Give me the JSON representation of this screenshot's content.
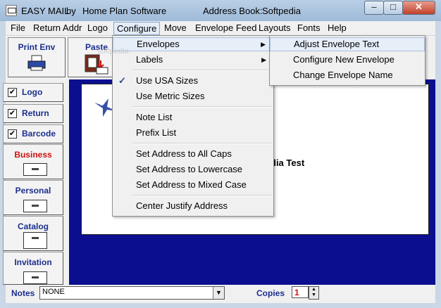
{
  "window": {
    "title_app": "EASY MAIL",
    "title_by": "by",
    "title_company": "Home Plan Software",
    "title_book_label": "Address Book:",
    "title_book_value": "Softpedia",
    "minimize": "–",
    "maximize": "□",
    "close": "✕"
  },
  "menubar": {
    "items": [
      "File",
      "Return Addr",
      "Logo",
      "Configure",
      "Move",
      "Envelope Feed",
      "Layouts",
      "Fonts",
      "Help"
    ]
  },
  "toolbar": {
    "print_env": "Print Env",
    "paste": "Paste"
  },
  "sidebar": {
    "checks": [
      {
        "label": "Logo",
        "checked": "✔"
      },
      {
        "label": "Return",
        "checked": "✔"
      },
      {
        "label": "Barcode",
        "checked": "✔"
      }
    ],
    "categories": [
      "Business",
      "Personal",
      "Catalog",
      "Invitation"
    ]
  },
  "envelope": {
    "address_fragment": "dia Test"
  },
  "watermark": "softpedia",
  "configure_menu": {
    "items": [
      "Envelopes",
      "Labels",
      "Use USA Sizes",
      "Use Metric Sizes",
      "Note List",
      "Prefix List",
      "Set Address to All Caps",
      "Set Address to Lowercase",
      "Set Address to Mixed Case",
      "Center Justify Address"
    ],
    "submenu_arrow": "▶",
    "checkmark": "✓"
  },
  "envelopes_submenu": {
    "items": [
      "Adjust Envelope Text",
      "Configure New Envelope",
      "Change Envelope Name"
    ]
  },
  "status": {
    "notes_label": "Notes",
    "notes_value": "NONE",
    "copies_label": "Copies",
    "copies_value": "1"
  },
  "colors": {
    "accent_blue": "#1b2f8f",
    "highlight_red": "#d01010",
    "envelope_area": "#0b0f8f"
  }
}
